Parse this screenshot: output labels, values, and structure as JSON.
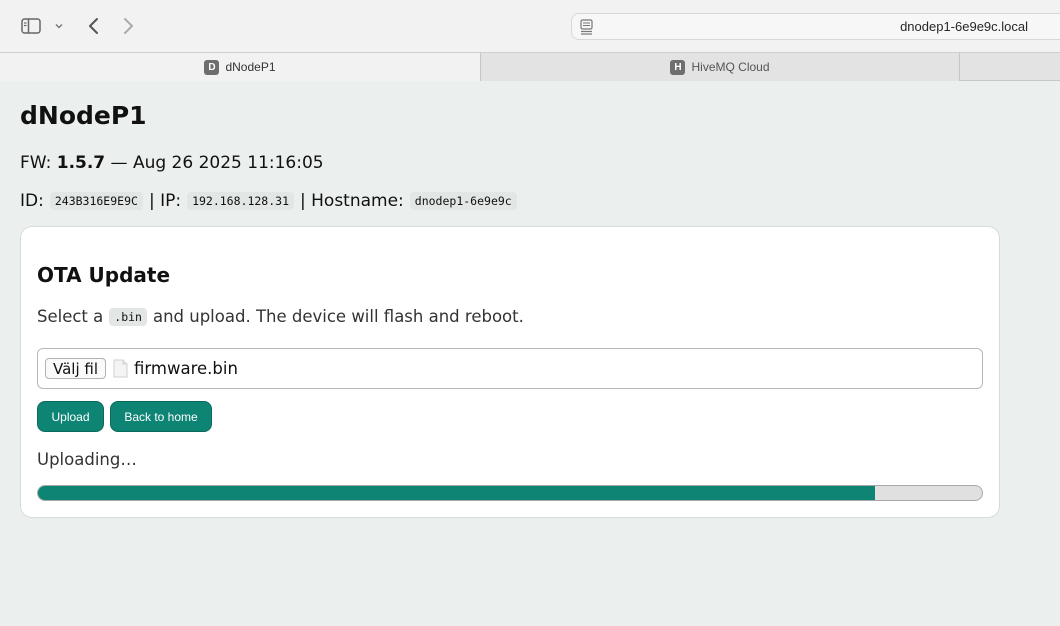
{
  "browser": {
    "url": "dnodep1-6e9e9c.local",
    "tabs": [
      {
        "label": "dNodeP1",
        "favicon": "D",
        "active": true
      },
      {
        "label": "HiveMQ Cloud",
        "favicon": "H",
        "active": false
      }
    ],
    "icons": {
      "sidebar": "sidebar-icon",
      "chevron": "chevron-down-icon",
      "back": "back-arrow-icon",
      "forward": "forward-arrow-icon",
      "reader": "reader-icon"
    }
  },
  "page": {
    "title": "dNodeP1",
    "fw": {
      "label": "FW:",
      "version": "1.5.7",
      "separator": "—",
      "build_date": "Aug 26 2025 11:16:05"
    },
    "ids": {
      "id_label": "ID:",
      "id_value": "243B316E9E9C",
      "ip_label": "| IP:",
      "ip_value": "192.168.128.31",
      "hostname_label": "| Hostname:",
      "hostname_value": "dnodep1-6e9e9c"
    }
  },
  "ota": {
    "title": "OTA Update",
    "desc_before": "Select a",
    "desc_code": ".bin",
    "desc_after": "and upload. The device will flash and reboot.",
    "file_button": "Välj fil",
    "file_name": "firmware.bin",
    "upload_label": "Upload",
    "home_label": "Back to home",
    "status": "Uploading…",
    "progress": 0.887
  },
  "colors": {
    "accent": "#0e8574",
    "background": "#ebf0ef"
  }
}
